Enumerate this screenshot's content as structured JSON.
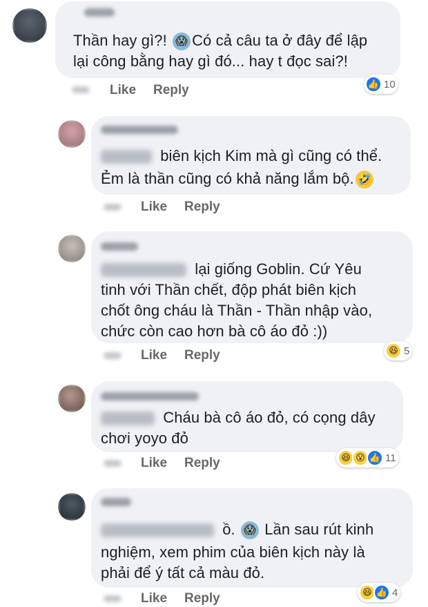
{
  "comments": [
    {
      "lines": [
        "Thần hay gì?! ",
        "Có cả câu ta ở đây để lập",
        "lại công bằng hay gì đó... hay t đọc sai?!"
      ],
      "actions": {
        "like": "Like",
        "reply": "Reply"
      },
      "reactions": {
        "count": "10",
        "icons": [
          "like"
        ]
      }
    },
    {
      "lines": [
        " biên kịch Kim mà gì cũng có thể.",
        "Ẻm là thần cũng có khả năng lắm bộ."
      ],
      "actions": {
        "like": "Like",
        "reply": "Reply"
      }
    },
    {
      "lines": [
        " lại giống Goblin. Cứ Yêu",
        "tinh với Thần chết, độp phát biên kịch",
        "chốt ông cháu là Thần - Thần nhập vào,",
        "chức còn cao hơn bà cô áo đỏ :))"
      ],
      "actions": {
        "like": "Like",
        "reply": "Reply"
      },
      "reactions": {
        "count": "5",
        "icons": [
          "haha"
        ]
      }
    },
    {
      "lines": [
        " Cháu bà cô áo đỏ, có cọng dây",
        "chơi yoyo đỏ"
      ],
      "actions": {
        "like": "Like",
        "reply": "Reply"
      },
      "reactions": {
        "count": "11",
        "icons": [
          "haha",
          "wow",
          "like"
        ]
      }
    },
    {
      "lines": [
        " ồ. ",
        " Lần sau rút kinh",
        "nghiệm, xem phim của biên kịch này là",
        "phải để ý tất cả màu đỏ."
      ],
      "actions": {
        "like": "Like",
        "reply": "Reply"
      },
      "reactions": {
        "count": "4",
        "icons": [
          "haha",
          "like"
        ]
      }
    }
  ],
  "colors": {
    "bubble": "#eff1f4",
    "action": "#65676b",
    "like_blue": "#1877f2",
    "emoji_yellow": "#f7d046"
  },
  "icons": {
    "scream": "face-screaming-in-fear-icon",
    "rofl": "rolling-on-floor-laughing-icon",
    "like": "thumbs-up-icon",
    "haha": "laughing-face-icon",
    "wow": "surprised-face-icon"
  }
}
